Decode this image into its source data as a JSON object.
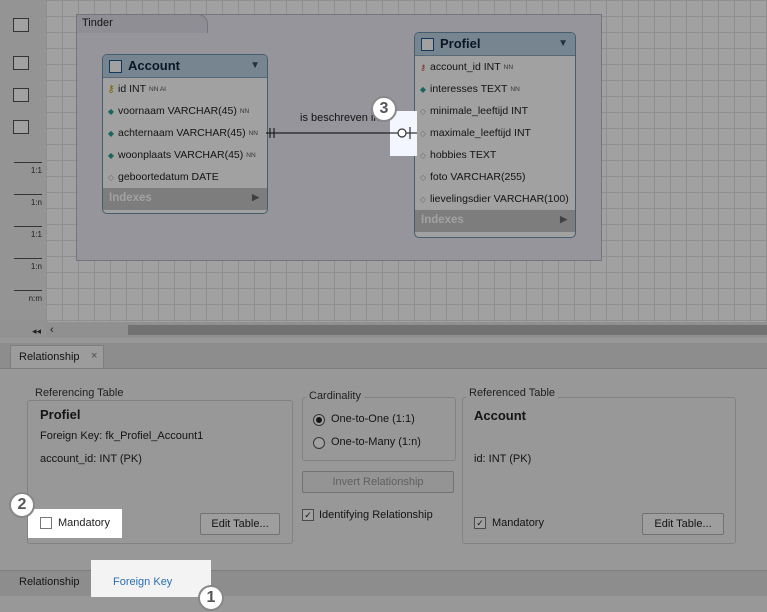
{
  "diagram": {
    "layer_name": "Tinder",
    "relationship_label": "is beschreven in",
    "tables": {
      "account": {
        "name": "Account",
        "columns": [
          {
            "icon": "key-icon",
            "text": "id INT",
            "flags": "NN AI"
          },
          {
            "icon": "diamond-icon",
            "text": "voornaam VARCHAR(45)",
            "flags": "NN"
          },
          {
            "icon": "diamond-icon",
            "text": "achternaam VARCHAR(45)",
            "flags": "NN"
          },
          {
            "icon": "diamond-icon",
            "text": "woonplaats VARCHAR(45)",
            "flags": "NN"
          },
          {
            "icon": "hollow-diamond-icon",
            "text": "geboortedatum DATE",
            "flags": ""
          }
        ],
        "indexes_label": "Indexes"
      },
      "profiel": {
        "name": "Profiel",
        "columns": [
          {
            "icon": "fk-key-icon",
            "text": "account_id INT",
            "flags": "NN"
          },
          {
            "icon": "diamond-icon",
            "text": "interesses TEXT",
            "flags": "NN"
          },
          {
            "icon": "hollow-diamond-icon",
            "text": "minimale_leeftijd INT",
            "flags": ""
          },
          {
            "icon": "hollow-diamond-icon",
            "text": "maximale_leeftijd INT",
            "flags": ""
          },
          {
            "icon": "hollow-diamond-icon",
            "text": "hobbies TEXT",
            "flags": ""
          },
          {
            "icon": "hollow-diamond-icon",
            "text": "foto VARCHAR(255)",
            "flags": ""
          },
          {
            "icon": "hollow-diamond-icon",
            "text": "lievelingsdier VARCHAR(100)",
            "flags": ""
          }
        ],
        "indexes_label": "Indexes"
      }
    }
  },
  "toolbar": {
    "relationship_tools": [
      "1:1",
      "1:n",
      "1:1",
      "1:n",
      "n:m"
    ]
  },
  "panel": {
    "tab_label": "Relationship",
    "referencing": {
      "group_title": "Referencing Table",
      "table_name": "Profiel",
      "foreign_key": "Foreign Key: fk_Profiel_Account1",
      "column": "account_id: INT (PK)",
      "mandatory_label": "Mandatory",
      "mandatory_checked": false,
      "edit_label": "Edit Table..."
    },
    "cardinality": {
      "group_title": "Cardinality",
      "options": [
        "One-to-One (1:1)",
        "One-to-Many (1:n)"
      ],
      "selected": "One-to-One (1:1)",
      "invert_label": "Invert Relationship",
      "identifying_label": "Identifying Relationship",
      "identifying_checked": true
    },
    "referenced": {
      "group_title": "Referenced Table",
      "table_name": "Account",
      "column": "id: INT (PK)",
      "mandatory_label": "Mandatory",
      "mandatory_checked": true,
      "edit_label": "Edit Table..."
    },
    "bottom_tabs": [
      "Relationship",
      "Foreign Key"
    ]
  },
  "callouts": [
    "1",
    "2",
    "3"
  ]
}
